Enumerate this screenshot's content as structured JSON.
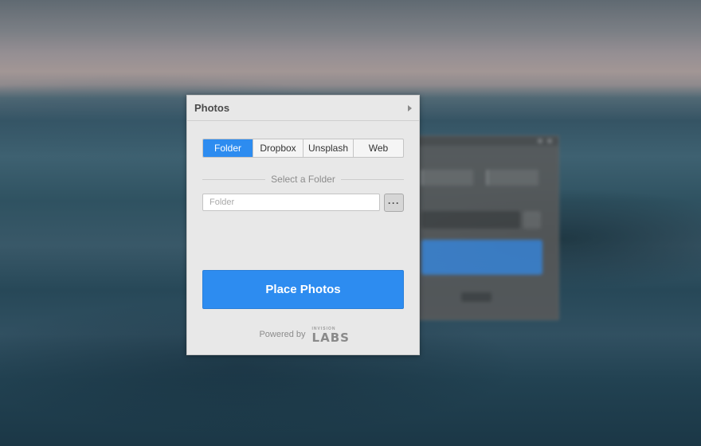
{
  "panel": {
    "title": "Photos",
    "tabs": [
      {
        "label": "Folder",
        "active": true
      },
      {
        "label": "Dropbox",
        "active": false
      },
      {
        "label": "Unsplash",
        "active": false
      },
      {
        "label": "Web",
        "active": false
      }
    ],
    "section_label": "Select a Folder",
    "folder_input": {
      "value": "",
      "placeholder": "Folder"
    },
    "browse_label": "···",
    "place_button_label": "Place Photos",
    "footer": {
      "powered_by": "Powered by",
      "logo_small": "INVISION",
      "logo_big": "LABS"
    }
  },
  "colors": {
    "accent": "#2d8cf0",
    "panel_bg": "#e8e8e8"
  }
}
